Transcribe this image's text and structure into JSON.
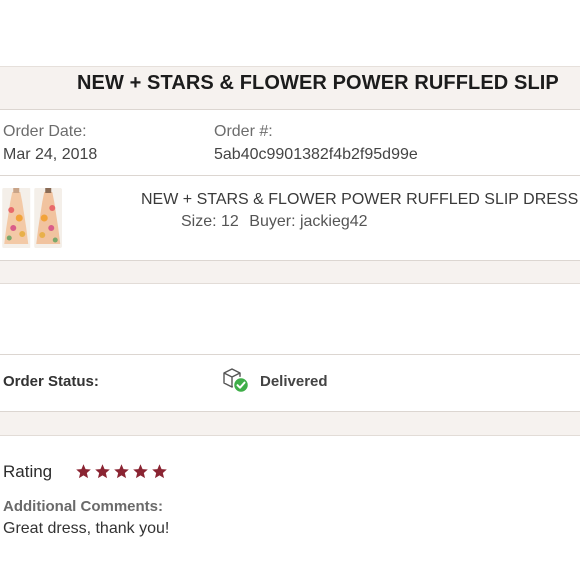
{
  "header": {
    "title": "NEW + STARS & FLOWER POWER RUFFLED SLIP"
  },
  "order": {
    "date_label": "Order Date:",
    "date_value": "Mar 24, 2018",
    "number_label": "Order #:",
    "number_value": "5ab40c9901382f4b2f95d99e"
  },
  "product": {
    "name": "NEW + STARS & FLOWER POWER RUFFLED SLIP DRESS",
    "size": "Size: 12",
    "buyer": "Buyer: jackieg42"
  },
  "status": {
    "label": "Order Status:",
    "value": "Delivered",
    "icon": "package-delivered-icon",
    "check_color": "#3fae49"
  },
  "review": {
    "rating_label": "Rating",
    "rating_value": 5,
    "rating_max": 5,
    "star_color": "#8a2432",
    "comments_label": "Additional Comments:",
    "comments_text": "Great dress, thank you!"
  }
}
